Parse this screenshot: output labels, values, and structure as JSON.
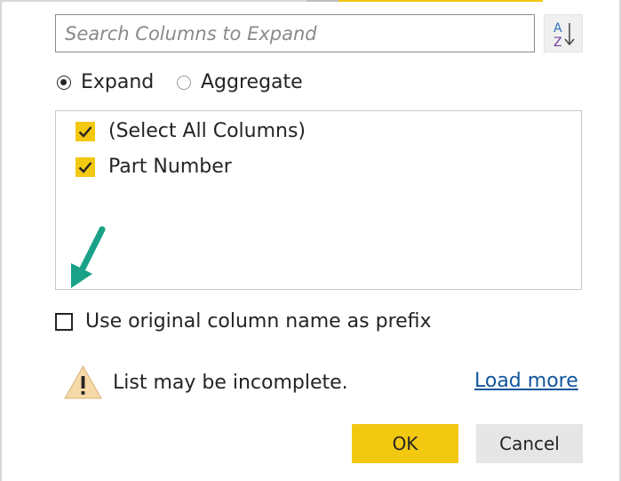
{
  "search": {
    "placeholder": "Search Columns to Expand",
    "value": ""
  },
  "sort_button": {
    "icon": "sort-az-icon",
    "glyph_top": "A",
    "glyph_bottom": "Z"
  },
  "mode": {
    "options": [
      {
        "label": "Expand",
        "selected": true
      },
      {
        "label": "Aggregate",
        "selected": false
      }
    ]
  },
  "columns": {
    "items": [
      {
        "label": "(Select All Columns)",
        "checked": true
      },
      {
        "label": "Part Number",
        "checked": true
      }
    ]
  },
  "prefix": {
    "label": "Use original column name as prefix",
    "checked": false
  },
  "warning": {
    "icon": "warning-icon",
    "text": "List may be incomplete."
  },
  "load_more": {
    "label": "Load more"
  },
  "buttons": {
    "ok": "OK",
    "cancel": "Cancel"
  },
  "colors": {
    "accent": "#f2c811",
    "arrow": "#1aa187",
    "link": "#11559c",
    "text": "#252423"
  }
}
